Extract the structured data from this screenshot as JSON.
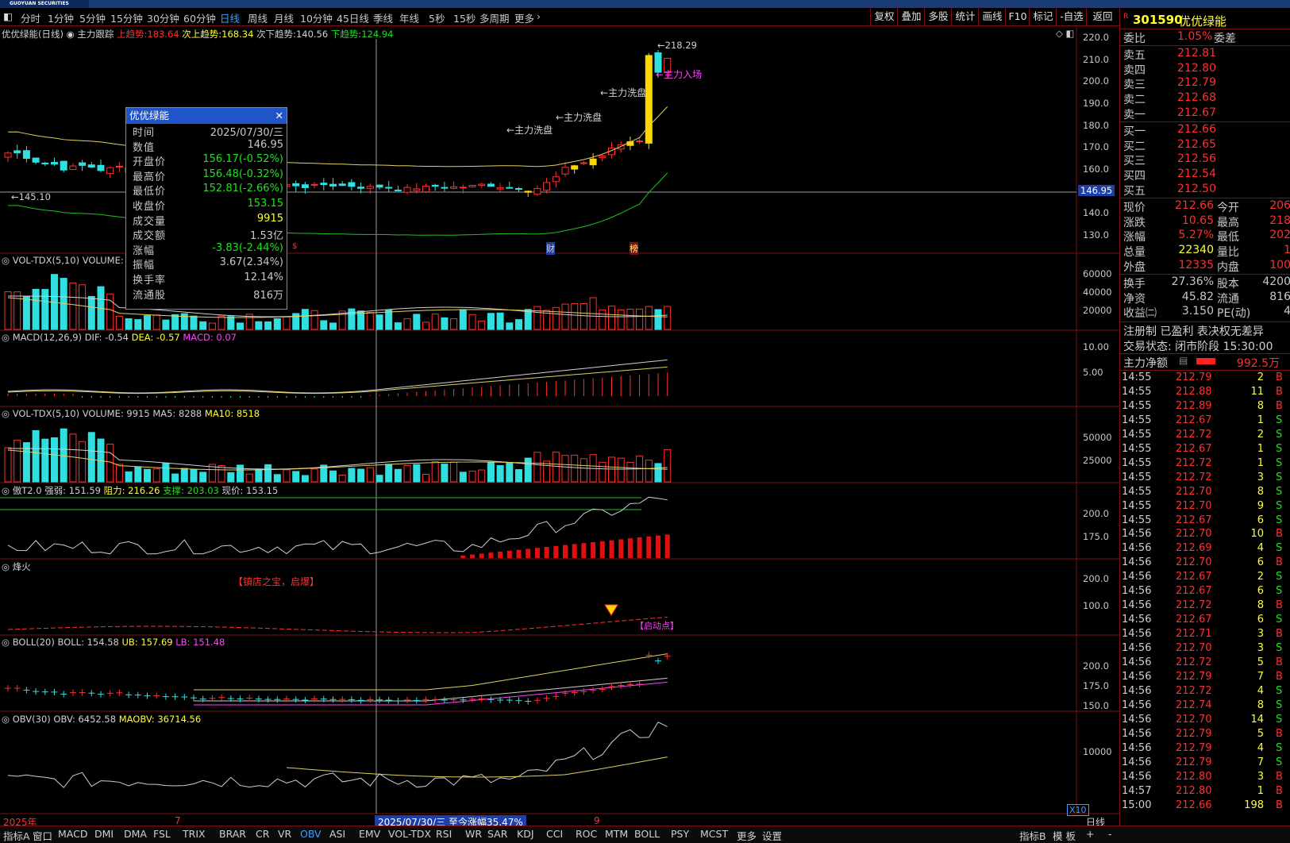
{
  "app": {
    "logo_text": "GUOYUAN SECURITIES"
  },
  "periods": [
    "分时",
    "1分钟",
    "5分钟",
    "15分钟",
    "30分钟",
    "60分钟",
    "日线",
    "周线",
    "月线",
    "10分钟",
    "45日线",
    "季线",
    "年线",
    "5秒",
    "15秒",
    "多周期",
    "更多"
  ],
  "active_period": "日线",
  "toolbar": [
    "复权",
    "叠加",
    "多股",
    "统计",
    "画线",
    "F10",
    "标记",
    "-自选",
    "返回"
  ],
  "main": {
    "stock": "优优绿能(日线)",
    "indicator": "主力跟踪",
    "up_trend_label": "上趋势:",
    "up_trend": "183.64",
    "sub_up_label": "次上趋势:",
    "sub_up": "168.34",
    "sub_down_label": "次下趋势:",
    "sub_down": "140.56",
    "down_label": "下趋势:",
    "down": "124.94",
    "price_axis": [
      "220.0",
      "210.0",
      "200.0",
      "190.0",
      "180.0",
      "170.0",
      "160.0",
      "140.0",
      "130.0"
    ],
    "current_line": "146.95",
    "low_mark": "145.10",
    "high_mark": "218.29",
    "annotations": [
      "主力洗盘",
      "主力洗盘",
      "主力洗盘",
      "主力入场"
    ],
    "event_tags": [
      "$",
      "财",
      "榜"
    ]
  },
  "popup": {
    "title": "优优绿能",
    "rows": [
      {
        "label": "时间",
        "value": "2025/07/30/三",
        "color": "#c8c8c8"
      },
      {
        "label": "数值",
        "value": "146.95",
        "color": "#c8c8c8"
      },
      {
        "label": "开盘价",
        "value": "156.17(-0.52%)",
        "color": "#20e020"
      },
      {
        "label": "最高价",
        "value": "156.48(-0.32%)",
        "color": "#20e020"
      },
      {
        "label": "最低价",
        "value": "152.81(-2.66%)",
        "color": "#20e020"
      },
      {
        "label": "收盘价",
        "value": "153.15",
        "color": "#20e020"
      },
      {
        "label": "成交量",
        "value": "9915",
        "color": "#ffff33"
      },
      {
        "label": "成交额",
        "value": "1.53亿",
        "color": "#c8c8c8"
      },
      {
        "label": "涨幅",
        "value": "-3.83(-2.44%)",
        "color": "#20e020"
      },
      {
        "label": "振幅",
        "value": "3.67(2.34%)",
        "color": "#c8c8c8"
      },
      {
        "label": "换手率",
        "value": "12.14%",
        "color": "#c8c8c8"
      },
      {
        "label": "流通股",
        "value": "816万",
        "color": "#c8c8c8"
      }
    ]
  },
  "panels": {
    "vol1": {
      "name": "VOL-TDX(5,10)",
      "text": "VOLUME:",
      "axis": [
        "60000",
        "40000",
        "20000"
      ]
    },
    "macd": {
      "name": "MACD(12,26,9)",
      "dif": "DIF: -0.54",
      "dea": "DEA: -0.57",
      "macd": "MACD: 0.07",
      "axis": [
        "10.00",
        "5.00"
      ]
    },
    "vol2": {
      "name": "VOL-TDX(5,10)",
      "volume": "VOLUME: 9915",
      "ma5": "MA5: 8288",
      "ma10": "MA10: 8518",
      "axis": [
        "50000",
        "25000"
      ]
    },
    "pt": {
      "name": "傲T2.0",
      "strong": "强弱: 151.59",
      "resist": "阻力: 216.26",
      "support": "支撑: 203.03",
      "price": "现价: 153.15",
      "axis": [
        "200.0",
        "175.0"
      ]
    },
    "fire": {
      "name": "烽火",
      "label": "【镇店之宝，启爆】",
      "start_label": "启动点",
      "axis": [
        "200.0",
        "100.0"
      ]
    },
    "boll": {
      "name": "BOLL(20)",
      "boll": "BOLL: 154.58",
      "ub": "UB: 157.69",
      "lb": "LB: 151.48",
      "axis": [
        "200.0",
        "175.0",
        "150.0"
      ]
    },
    "obv": {
      "name": "OBV(30)",
      "obv": "OBV: 6452.58",
      "maobv": "MAOBV: 36714.56",
      "axis": [
        "10000"
      ],
      "scale": "X10"
    }
  },
  "dateaxis": {
    "year": "2025年",
    "m7": "7",
    "m9": "9",
    "cursor": "2025/07/30/三",
    "range": "至今涨幅35.47%",
    "mode": "日线"
  },
  "right": {
    "code": "301590",
    "name": "优优绿能",
    "weibi_label": "委比",
    "weibi": "1.05%",
    "weicha_label": "委差",
    "asks": [
      {
        "label": "卖五",
        "price": "212.81"
      },
      {
        "label": "卖四",
        "price": "212.80"
      },
      {
        "label": "卖三",
        "price": "212.79"
      },
      {
        "label": "卖二",
        "price": "212.68"
      },
      {
        "label": "卖一",
        "price": "212.67"
      }
    ],
    "bids": [
      {
        "label": "买一",
        "price": "212.66"
      },
      {
        "label": "买二",
        "price": "212.65"
      },
      {
        "label": "买三",
        "price": "212.56"
      },
      {
        "label": "买四",
        "price": "212.54"
      },
      {
        "label": "买五",
        "price": "212.50"
      }
    ],
    "stats": [
      {
        "l1": "现价",
        "v1": "212.66",
        "c1": "#ff3030",
        "l2": "今开",
        "v2": "206"
      },
      {
        "l1": "涨跌",
        "v1": "10.65",
        "c1": "#ff3030",
        "l2": "最高",
        "v2": "218"
      },
      {
        "l1": "涨幅",
        "v1": "5.27%",
        "c1": "#ff3030",
        "l2": "最低",
        "v2": "202"
      },
      {
        "l1": "总量",
        "v1": "22340",
        "c1": "#ffff33",
        "l2": "量比",
        "v2": "1"
      },
      {
        "l1": "外盘",
        "v1": "12335",
        "c1": "#ff3030",
        "l2": "内盘",
        "v2": "100"
      }
    ],
    "stats2": [
      {
        "l1": "换手",
        "v1": "27.36%",
        "l2": "股本",
        "v2": "4200"
      },
      {
        "l1": "净资",
        "v1": "45.82",
        "l2": "流通",
        "v2": "816"
      },
      {
        "l1": "收益㈡",
        "v1": "3.150",
        "l2": "PE(动)",
        "v2": "4"
      }
    ],
    "reg": "注册制 已盈利 表决权无差异",
    "trade_state": "交易状态: 闭市阶段 15:30:00",
    "main_flow_label": "主力净额",
    "main_flow": "992.5万",
    "ticks": [
      [
        "14:55",
        "212.79",
        "2",
        "B"
      ],
      [
        "14:55",
        "212.88",
        "11",
        "B"
      ],
      [
        "14:55",
        "212.89",
        "8",
        "B"
      ],
      [
        "14:55",
        "212.67",
        "1",
        "S"
      ],
      [
        "14:55",
        "212.72",
        "2",
        "S"
      ],
      [
        "14:55",
        "212.67",
        "1",
        "S"
      ],
      [
        "14:55",
        "212.72",
        "1",
        "S"
      ],
      [
        "14:55",
        "212.72",
        "3",
        "S"
      ],
      [
        "14:55",
        "212.70",
        "8",
        "S"
      ],
      [
        "14:55",
        "212.70",
        "9",
        "S"
      ],
      [
        "14:55",
        "212.67",
        "6",
        "S"
      ],
      [
        "14:56",
        "212.70",
        "10",
        "B"
      ],
      [
        "14:56",
        "212.69",
        "4",
        "S"
      ],
      [
        "14:56",
        "212.70",
        "6",
        "B"
      ],
      [
        "14:56",
        "212.67",
        "2",
        "S"
      ],
      [
        "14:56",
        "212.67",
        "6",
        "S"
      ],
      [
        "14:56",
        "212.72",
        "8",
        "B"
      ],
      [
        "14:56",
        "212.67",
        "6",
        "S"
      ],
      [
        "14:56",
        "212.71",
        "3",
        "B"
      ],
      [
        "14:56",
        "212.70",
        "3",
        "S"
      ],
      [
        "14:56",
        "212.72",
        "5",
        "B"
      ],
      [
        "14:56",
        "212.79",
        "7",
        "B"
      ],
      [
        "14:56",
        "212.72",
        "4",
        "S"
      ],
      [
        "14:56",
        "212.74",
        "8",
        "S"
      ],
      [
        "14:56",
        "212.70",
        "14",
        "S"
      ],
      [
        "14:56",
        "212.79",
        "5",
        "B"
      ],
      [
        "14:56",
        "212.79",
        "4",
        "S"
      ],
      [
        "14:56",
        "212.79",
        "7",
        "S"
      ],
      [
        "14:56",
        "212.80",
        "3",
        "B"
      ],
      [
        "14:57",
        "212.80",
        "1",
        "B"
      ],
      [
        "15:00",
        "212.66",
        "198",
        "B"
      ]
    ]
  },
  "indicators": [
    "指标A",
    "窗口",
    "MACD",
    "DMI",
    "DMA",
    "FSL",
    "TRIX",
    "BRAR",
    "CR",
    "VR",
    "OBV",
    "ASI",
    "EMV",
    "VOL-TDX",
    "RSI",
    "WR",
    "SAR",
    "KDJ",
    "CCI",
    "ROC",
    "MTM",
    "BOLL",
    "PSY",
    "MCST",
    "更多",
    "设置"
  ],
  "active_indicator": "OBV",
  "bottom_right": [
    "指标B",
    "模 板",
    "+",
    "-"
  ],
  "colors": {
    "up": "#ff3030",
    "down": "#30e0e0",
    "grid": "#7a1010",
    "accent": "#3fa0ff"
  }
}
